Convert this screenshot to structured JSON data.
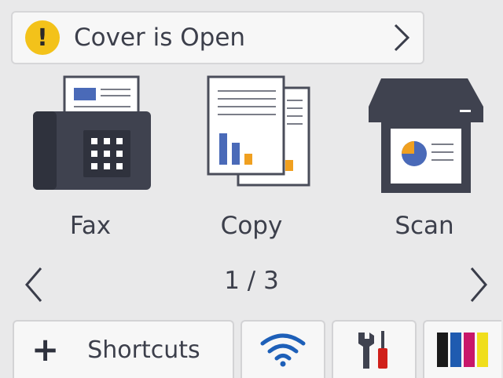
{
  "status": {
    "icon": "warning-icon",
    "message": "Cover is Open",
    "accent_color": "#f3c21a"
  },
  "apps": [
    {
      "label": "Fax",
      "icon": "fax-icon"
    },
    {
      "label": "Copy",
      "icon": "copy-icon"
    },
    {
      "label": "Scan",
      "icon": "scan-icon"
    }
  ],
  "pager": {
    "page_text": "1 / 3",
    "prev_icon": "chevron-left-icon",
    "next_icon": "chevron-right-icon"
  },
  "bottom_bar": {
    "shortcuts_label": "Shortcuts",
    "shortcuts_icon": "plus-icon",
    "wifi_icon": "wifi-icon",
    "settings_icon": "settings-tools-icon",
    "ink_icon": "ink-level-icon",
    "ink_colors": [
      "#1a1a1a",
      "#1f5bb0",
      "#c8176a",
      "#f0de1c"
    ]
  }
}
